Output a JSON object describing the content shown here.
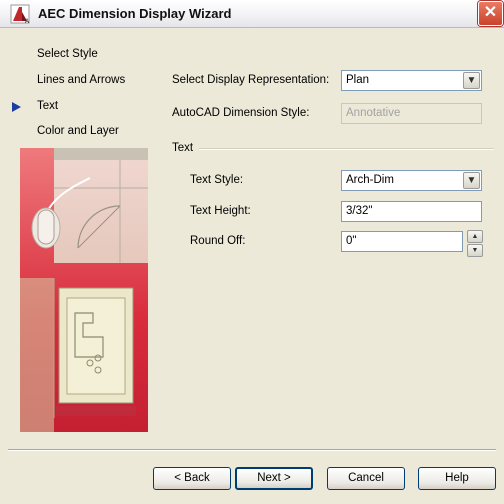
{
  "window": {
    "title": "AEC Dimension Display Wizard"
  },
  "steps": [
    {
      "label": "Select Style"
    },
    {
      "label": "Lines and Arrows"
    },
    {
      "label": "Text"
    },
    {
      "label": "Color and Layer"
    }
  ],
  "form": {
    "display_rep_label": "Select Display Representation:",
    "display_rep_value": "Plan",
    "dim_style_label": "AutoCAD Dimension Style:",
    "dim_style_value": "Annotative",
    "group_text_label": "Text",
    "text_style_label": "Text Style:",
    "text_style_value": "Arch-Dim",
    "text_height_label": "Text Height:",
    "text_height_value": "3/32\"",
    "round_off_label": "Round Off:",
    "round_off_value": "0\""
  },
  "buttons": {
    "back": "< Back",
    "next": "Next >",
    "cancel": "Cancel",
    "help": "Help"
  },
  "colors": {
    "title_bar": "#f3f3f6",
    "dialog_bg": "#ece9d8",
    "close_button": "#d9553c",
    "active_step_arrow": "#1b3fa0",
    "art_red": "#d42a3a"
  }
}
